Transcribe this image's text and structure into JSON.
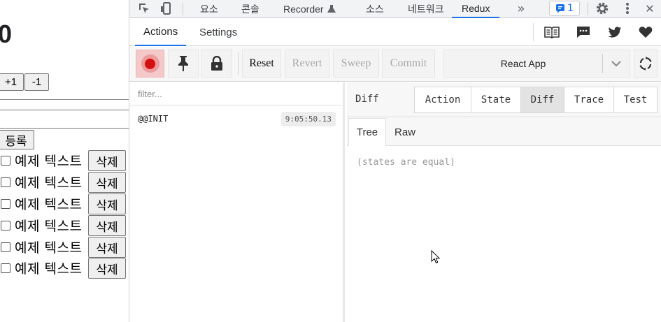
{
  "app": {
    "counter": "0",
    "increment_label": "+1",
    "decrement_label": "-1",
    "register_label": "등록",
    "todos": [
      {
        "text": "예제 텍스트",
        "delete_label": "삭제"
      },
      {
        "text": "예제 텍스트",
        "delete_label": "삭제"
      },
      {
        "text": "예제 텍스트",
        "delete_label": "삭제"
      },
      {
        "text": "예제 텍스트",
        "delete_label": "삭제"
      },
      {
        "text": "예제 텍스트",
        "delete_label": "삭제"
      },
      {
        "text": "예제 텍스트",
        "delete_label": "삭제"
      }
    ]
  },
  "devtools": {
    "tabs": [
      "요소",
      "콘솔",
      "Recorder",
      "소스",
      "네트워크",
      "Redux"
    ],
    "active_tab": "Redux",
    "issues_count": "1",
    "icons": [
      "inspect-icon",
      "device-toggle-icon",
      "more-tabs-icon",
      "issues-icon",
      "gear-icon",
      "kebab-menu-icon"
    ]
  },
  "redux": {
    "nav_tabs": [
      "Actions",
      "Settings"
    ],
    "active_nav": "Actions",
    "nav_icons": [
      "docs-icon",
      "chat-icon",
      "twitter-icon",
      "heart-icon"
    ],
    "toolbar": {
      "reset": "Reset",
      "revert": "Revert",
      "sweep": "Sweep",
      "commit": "Commit",
      "instance": "React App"
    },
    "filter_placeholder": "filter...",
    "actions": [
      {
        "name": "@@INIT",
        "time": "9:05:50.13"
      }
    ],
    "monitor": {
      "title": "Diff",
      "tabs": [
        "Action",
        "State",
        "Diff",
        "Trace",
        "Test"
      ],
      "active_tab": "Diff",
      "sub_tabs": [
        "Tree",
        "Raw"
      ],
      "active_sub_tab": "Tree",
      "message": "(states are equal)"
    }
  },
  "colors": {
    "accent": "#1a73e8",
    "record": "#d40f0f",
    "disabled": "#a9a9a9"
  }
}
